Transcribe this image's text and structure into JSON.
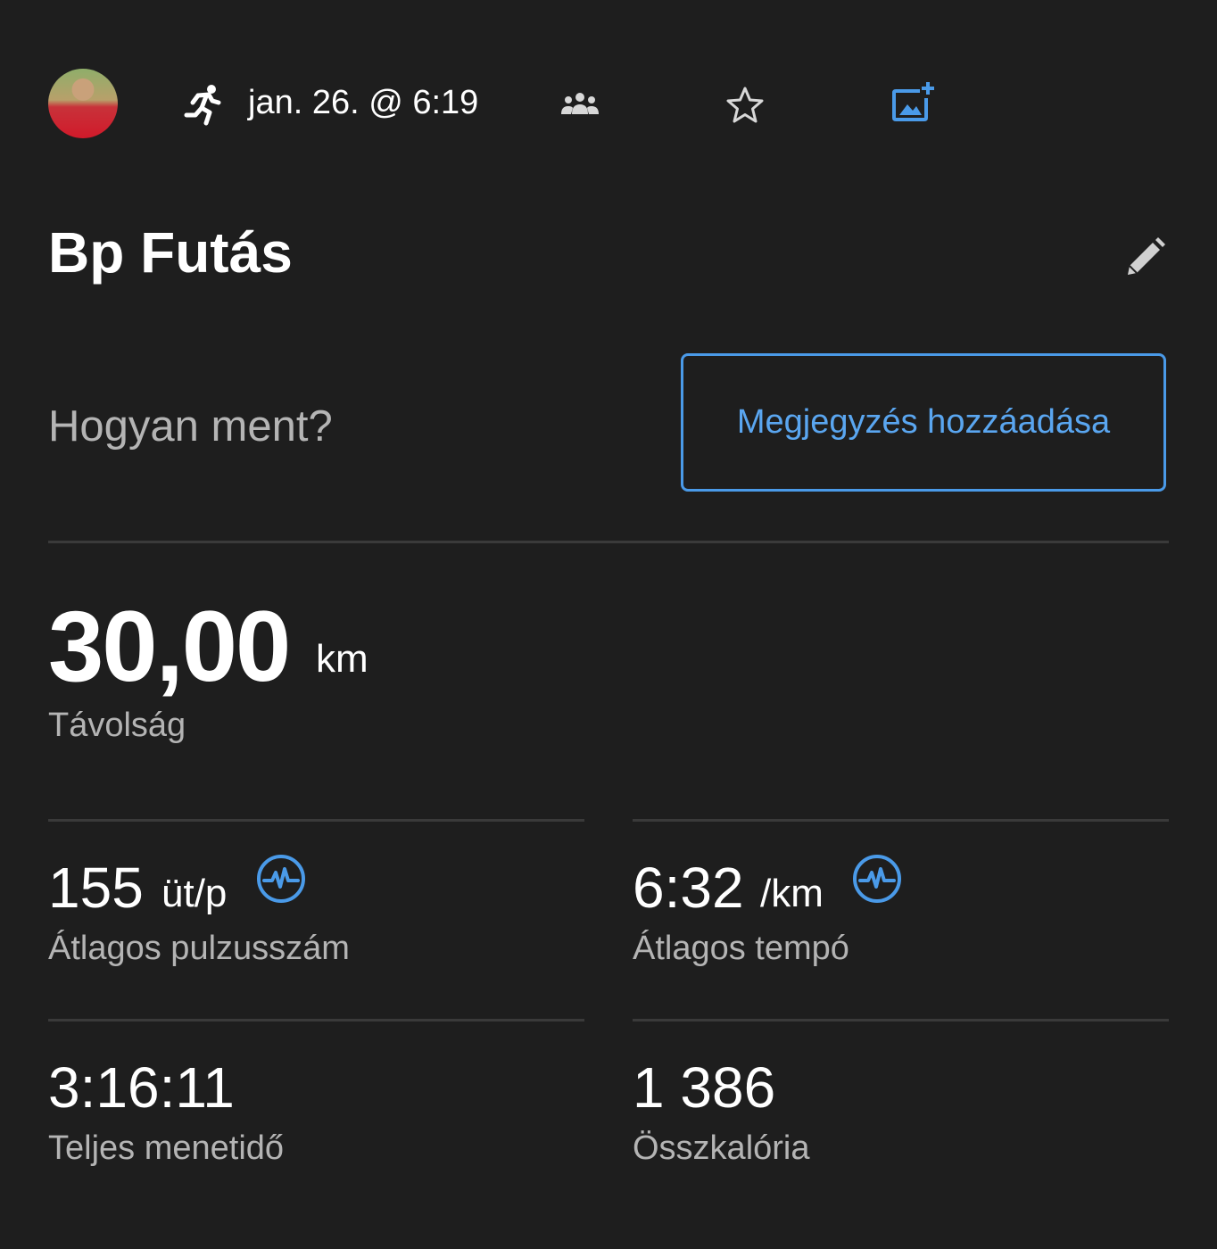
{
  "header": {
    "date_time": "jan. 26. @ 6:19",
    "icons": [
      "avatar",
      "running-icon",
      "group-icon",
      "star-icon",
      "add-photo-icon"
    ]
  },
  "activity": {
    "title": "Bp Futás",
    "prompt": "Hogyan ment?",
    "add_note_label": "Megjegyzés hozzáadása"
  },
  "distance": {
    "value": "30,00",
    "unit": "km",
    "label": "Távolság"
  },
  "stats": {
    "heart_rate": {
      "value": "155",
      "unit": "üt/p",
      "label": "Átlagos pulzusszám"
    },
    "pace": {
      "value": "6:32",
      "unit": "/km",
      "label": "Átlagos tempó"
    },
    "time": {
      "value": "3:16:11",
      "label": "Teljes menetidő"
    },
    "calories": {
      "value": "1 386",
      "label": "Összkalória"
    }
  },
  "colors": {
    "background": "#1e1e1e",
    "accent": "#4a9ae8",
    "secondary_text": "#b4b4b4",
    "divider": "#3a3a3a"
  }
}
